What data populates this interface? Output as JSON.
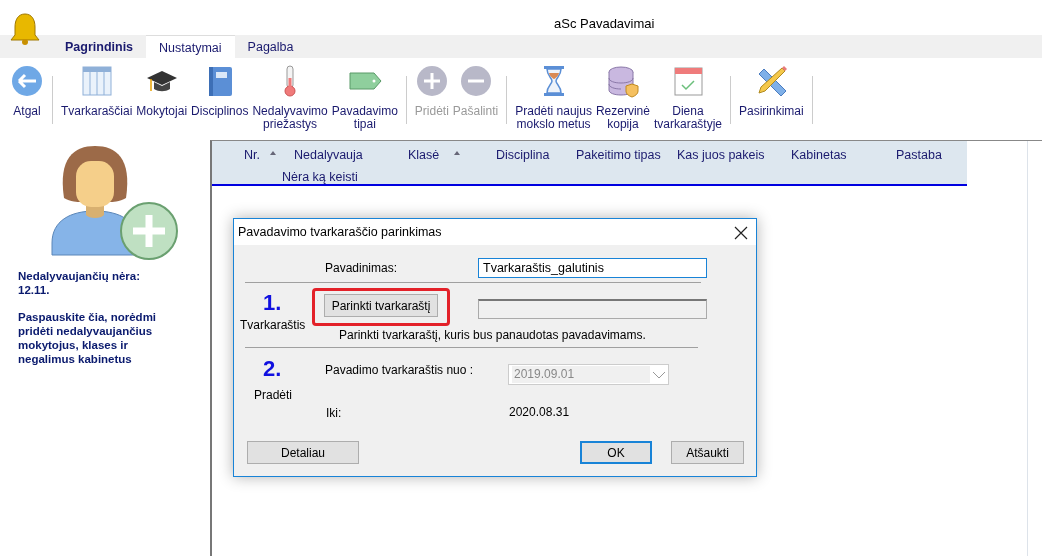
{
  "window": {
    "title": "aSc Pavadavimai"
  },
  "tabs": [
    {
      "label": "Pagrindinis",
      "selected": false,
      "bold": true
    },
    {
      "label": "Nustatymai",
      "selected": true,
      "bold": false
    },
    {
      "label": "Pagalba",
      "selected": false,
      "bold": false
    }
  ],
  "toolbar": {
    "groups": [
      [
        {
          "label": "Atgal",
          "disabled": false
        }
      ],
      [
        {
          "label": "Tvarkaraščiai",
          "disabled": false
        },
        {
          "label": "Mokytojai",
          "disabled": false
        },
        {
          "label": "Disciplinos",
          "disabled": false
        },
        {
          "label": "Nedalyvavimo\npriežastys",
          "disabled": false
        },
        {
          "label": "Pavadavimo\ntipai",
          "disabled": false
        }
      ],
      [
        {
          "label": "Pridėti",
          "disabled": true
        },
        {
          "label": "Pašalinti",
          "disabled": true
        }
      ],
      [
        {
          "label": "Pradėti naujus\nmokslo metus",
          "disabled": false
        },
        {
          "label": "Rezervinė\nkopija",
          "disabled": false
        },
        {
          "label": "Diena\ntvarkaraštyje",
          "disabled": false
        }
      ],
      [
        {
          "label": "Pasirinkimai",
          "disabled": false
        }
      ]
    ]
  },
  "sidebar": {
    "status": "Nedalyvaujančių nėra:\n12.11.",
    "hint": "Paspauskite čia, norėdmi pridėti nedalyvaujančius mokytojus, klases ir negalimus kabinetus"
  },
  "table": {
    "columns": [
      {
        "label": "Nr.",
        "sorted": true
      },
      {
        "label": "Nedalyvauja",
        "sorted": false
      },
      {
        "label": "Klasė",
        "sorted": true
      },
      {
        "label": "Disciplina",
        "sorted": false
      },
      {
        "label": "Pakeitimo tipas",
        "sorted": false
      },
      {
        "label": "Kas juos pakeis",
        "sorted": false
      },
      {
        "label": "Kabinetas",
        "sorted": false
      },
      {
        "label": "Pastaba",
        "sorted": false
      }
    ],
    "empty_message": "Nėra ką keisti"
  },
  "dialog": {
    "title": "Pavadavimo tvarkaraščio parinkimas",
    "name_label": "Pavadinimas:",
    "name_value": "Tvarkaraštis_galutinis",
    "step1": {
      "number": "1.",
      "label": "Tvarkaraštis",
      "button": "Parinkti tvarkaraštį",
      "description": "Parinkti tvarkaraštį, kuris bus panaudotas pavadavimams.",
      "highlighted": true
    },
    "step2": {
      "number": "2.",
      "label": "Pradėti",
      "from_label": "Pavadimo tvarkaraštis nuo :",
      "from_value": "2019.09.01",
      "from_disabled": true,
      "to_label": "Iki:",
      "to_value": "2020.08.31"
    },
    "buttons": [
      {
        "label": "Detaliau",
        "default": false
      },
      {
        "label": "OK",
        "default": true
      },
      {
        "label": "Atšaukti",
        "default": false
      }
    ]
  }
}
